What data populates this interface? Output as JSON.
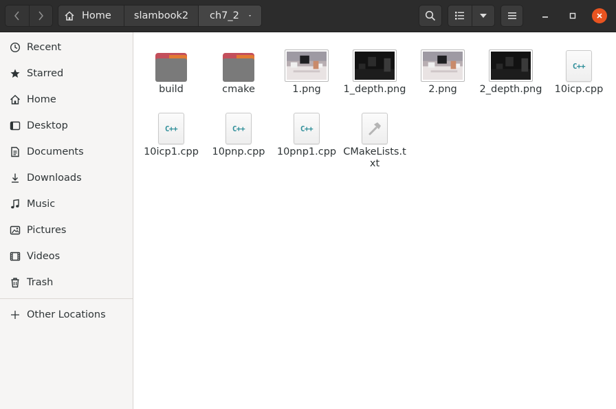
{
  "toolbar": {
    "back_icon": "chevron-left-icon",
    "forward_icon": "chevron-right-icon",
    "search_icon": "search-icon",
    "list_view_icon": "list-view-icon",
    "menu_icon": "hamburger-menu-icon"
  },
  "breadcrumb": {
    "home": "Home",
    "parent": "slambook2",
    "current": "ch7_2"
  },
  "sidebar": {
    "items": [
      {
        "label": "Recent",
        "icon": "clock-icon"
      },
      {
        "label": "Starred",
        "icon": "star-icon"
      },
      {
        "label": "Home",
        "icon": "home-icon"
      },
      {
        "label": "Desktop",
        "icon": "desktop-icon"
      },
      {
        "label": "Documents",
        "icon": "document-icon"
      },
      {
        "label": "Downloads",
        "icon": "download-icon"
      },
      {
        "label": "Music",
        "icon": "music-icon"
      },
      {
        "label": "Pictures",
        "icon": "pictures-icon"
      },
      {
        "label": "Videos",
        "icon": "video-icon"
      },
      {
        "label": "Trash",
        "icon": "trash-icon"
      }
    ],
    "other_locations": {
      "label": "Other Locations",
      "icon": "plus-icon"
    }
  },
  "files": [
    {
      "name": "build",
      "type": "folder"
    },
    {
      "name": "cmake",
      "type": "folder"
    },
    {
      "name": "1.png",
      "type": "image-color"
    },
    {
      "name": "1_depth.png",
      "type": "image-depth"
    },
    {
      "name": "2.png",
      "type": "image-color"
    },
    {
      "name": "2_depth.png",
      "type": "image-depth"
    },
    {
      "name": "10icp.cpp",
      "type": "cpp"
    },
    {
      "name": "10icp1.cpp",
      "type": "cpp"
    },
    {
      "name": "10pnp.cpp",
      "type": "cpp"
    },
    {
      "name": "10pnp1.cpp",
      "type": "cpp"
    },
    {
      "name": "CMakeLists.txt",
      "type": "cmake"
    }
  ],
  "cpp_badge": "C++",
  "colors": {
    "headerbar": "#2c2c2c",
    "sidebar": "#f6f5f4",
    "folder_tab": "#c34f5b",
    "folder_body": "#7a7a7a",
    "close_button": "#e95420",
    "cpp_text": "#2f8f9a"
  }
}
